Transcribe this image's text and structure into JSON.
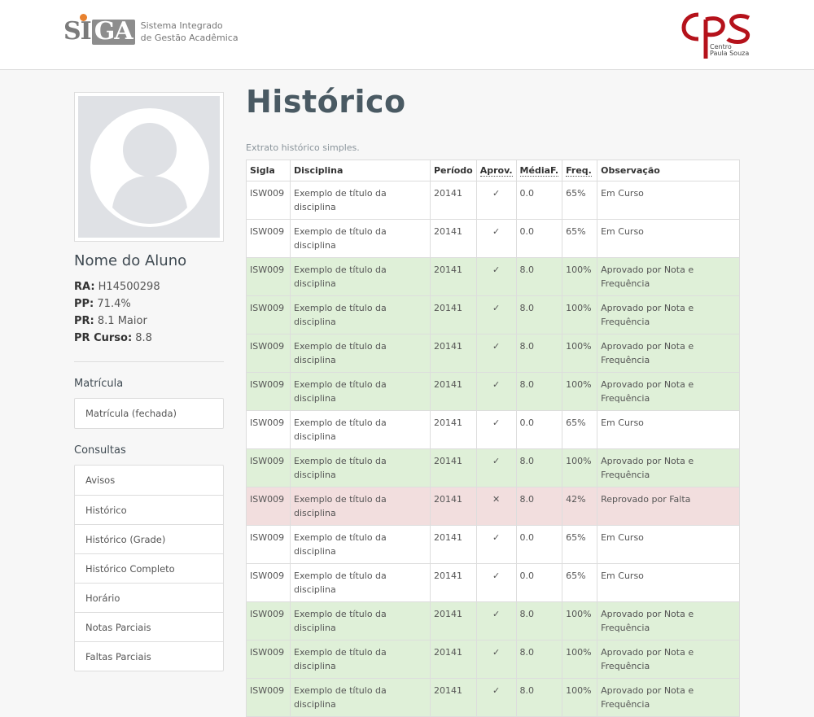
{
  "header": {
    "siga_mark_si": "SI",
    "siga_mark_ga": "GA",
    "siga_line1": "Sistema Integrado",
    "siga_line2": "de Gestão Acadêmica",
    "cps_line1": "Centro",
    "cps_line2": "Paula Souza"
  },
  "student": {
    "name": "Nome do Aluno",
    "ra_label": "RA:",
    "ra": "H14500298",
    "pp_label": "PP:",
    "pp": "71.4%",
    "pr_label": "PR:",
    "pr": "8.1 Maior",
    "prcurso_label": "PR Curso:",
    "prcurso": "8.8"
  },
  "sidebar": {
    "matricula_title": "Matrícula",
    "matricula_items": [
      "Matrícula (fechada)"
    ],
    "consultas_title": "Consultas",
    "consultas_items": [
      "Avisos",
      "Histórico",
      "Histórico (Grade)",
      "Histórico Completo",
      "Horário",
      "Notas Parciais",
      "Faltas Parciais"
    ]
  },
  "main": {
    "title": "Histórico",
    "subtitle": "Extrato histórico simples.",
    "columns": [
      "Sigla",
      "Disciplina",
      "Período",
      "Aprov.",
      "MédiaF.",
      "Freq.",
      "Observação"
    ],
    "rows": [
      {
        "status": "",
        "sigla": "ISW009",
        "disciplina": "Exemplo de título da disciplina",
        "periodo": "20141",
        "aprov": "✓",
        "media": "0.0",
        "freq": "65%",
        "obs": "Em Curso"
      },
      {
        "status": "",
        "sigla": "ISW009",
        "disciplina": "Exemplo de título da disciplina",
        "periodo": "20141",
        "aprov": "✓",
        "media": "0.0",
        "freq": "65%",
        "obs": "Em Curso"
      },
      {
        "status": "success",
        "sigla": "ISW009",
        "disciplina": "Exemplo de título da disciplina",
        "periodo": "20141",
        "aprov": "✓",
        "media": "8.0",
        "freq": "100%",
        "obs": "Aprovado por Nota e Frequência"
      },
      {
        "status": "success",
        "sigla": "ISW009",
        "disciplina": "Exemplo de título da disciplina",
        "periodo": "20141",
        "aprov": "✓",
        "media": "8.0",
        "freq": "100%",
        "obs": "Aprovado por Nota e Frequência"
      },
      {
        "status": "success",
        "sigla": "ISW009",
        "disciplina": "Exemplo de título da disciplina",
        "periodo": "20141",
        "aprov": "✓",
        "media": "8.0",
        "freq": "100%",
        "obs": "Aprovado por Nota e Frequência"
      },
      {
        "status": "success",
        "sigla": "ISW009",
        "disciplina": "Exemplo de título da disciplina",
        "periodo": "20141",
        "aprov": "✓",
        "media": "8.0",
        "freq": "100%",
        "obs": "Aprovado por Nota e Frequência"
      },
      {
        "status": "",
        "sigla": "ISW009",
        "disciplina": "Exemplo de título da disciplina",
        "periodo": "20141",
        "aprov": "✓",
        "media": "0.0",
        "freq": "65%",
        "obs": "Em Curso"
      },
      {
        "status": "success",
        "sigla": "ISW009",
        "disciplina": "Exemplo de título da disciplina",
        "periodo": "20141",
        "aprov": "✓",
        "media": "8.0",
        "freq": "100%",
        "obs": "Aprovado por Nota e Frequência"
      },
      {
        "status": "danger",
        "sigla": "ISW009",
        "disciplina": "Exemplo de título da disciplina",
        "periodo": "20141",
        "aprov": "✕",
        "media": "8.0",
        "freq": "42%",
        "obs": "Reprovado por Falta"
      },
      {
        "status": "",
        "sigla": "ISW009",
        "disciplina": "Exemplo de título da disciplina",
        "periodo": "20141",
        "aprov": "✓",
        "media": "0.0",
        "freq": "65%",
        "obs": "Em Curso"
      },
      {
        "status": "",
        "sigla": "ISW009",
        "disciplina": "Exemplo de título da disciplina",
        "periodo": "20141",
        "aprov": "✓",
        "media": "0.0",
        "freq": "65%",
        "obs": "Em Curso"
      },
      {
        "status": "success",
        "sigla": "ISW009",
        "disciplina": "Exemplo de título da disciplina",
        "periodo": "20141",
        "aprov": "✓",
        "media": "8.0",
        "freq": "100%",
        "obs": "Aprovado por Nota e Frequência"
      },
      {
        "status": "success",
        "sigla": "ISW009",
        "disciplina": "Exemplo de título da disciplina",
        "periodo": "20141",
        "aprov": "✓",
        "media": "8.0",
        "freq": "100%",
        "obs": "Aprovado por Nota e Frequência"
      },
      {
        "status": "success",
        "sigla": "ISW009",
        "disciplina": "Exemplo de título da disciplina",
        "periodo": "20141",
        "aprov": "✓",
        "media": "8.0",
        "freq": "100%",
        "obs": "Aprovado por Nota e Frequência"
      }
    ]
  },
  "colors": {
    "success_row": "#dff0d8",
    "danger_row": "#f2dede",
    "siga_accent": "#e8822f",
    "cps_red": "#b5121b"
  },
  "icons": {
    "approved": "check-icon",
    "failed": "cross-icon",
    "avatar": "user-silhouette-icon"
  }
}
